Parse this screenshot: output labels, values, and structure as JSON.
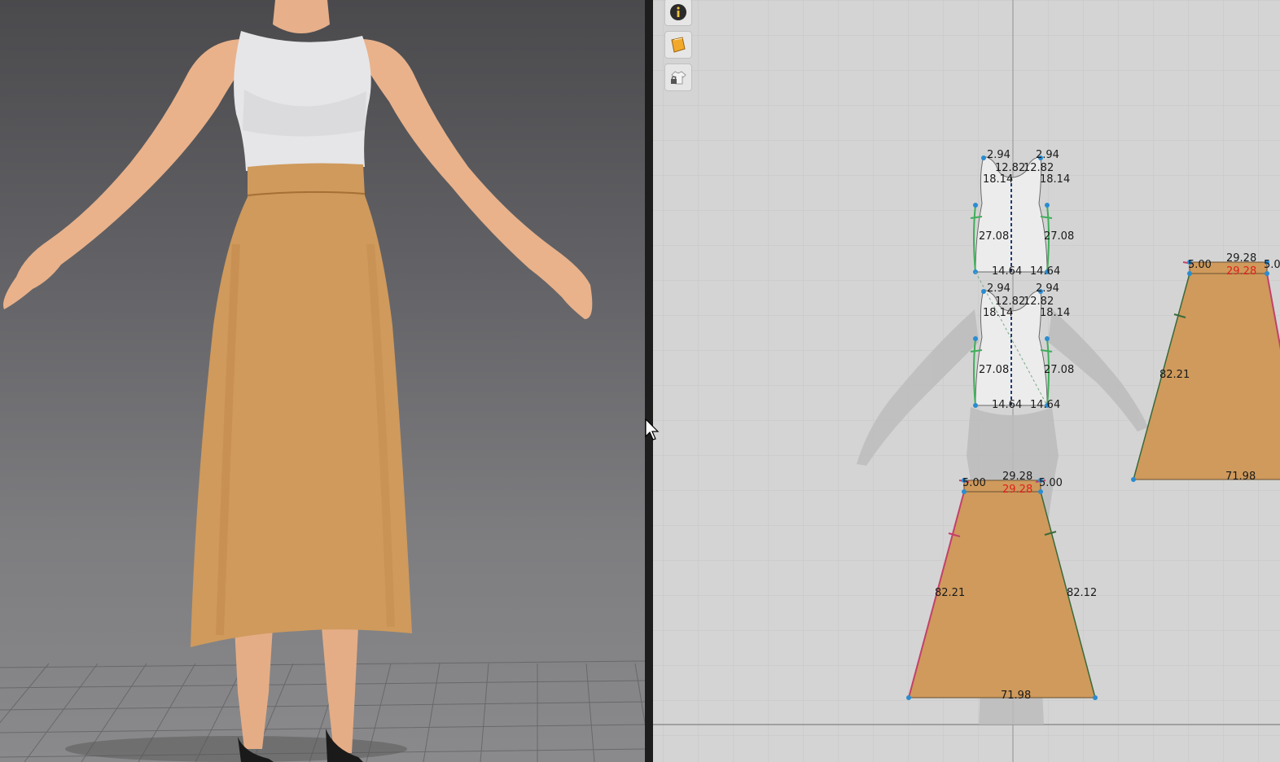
{
  "colors": {
    "skirt_fabric": "#cf9a5c",
    "top_fabric": "#e8e8ea",
    "viewport2d_bg": "#d4d4d4",
    "highlight_red": "#e0201c"
  },
  "toolbar2d": {
    "info_icon": "info-icon",
    "fabric_icon": "fabric-swatch-icon",
    "lock_icon": "garment-lock-icon"
  },
  "patterns": {
    "bodice_front": {
      "shoulder_left": "2.94",
      "shoulder_right": "2.94",
      "neck_left": "12.82",
      "neck_right": "12.82",
      "armhole_left": "18.14",
      "armhole_right": "18.14",
      "side_left": "27.08",
      "side_right": "27.08",
      "hem_left": "14.64",
      "hem_right": "14.64"
    },
    "bodice_back": {
      "shoulder_left": "2.94",
      "shoulder_right": "2.94",
      "neck_left": "12.82",
      "neck_right": "12.82",
      "armhole_left": "18.14",
      "armhole_right": "18.14",
      "side_left": "27.08",
      "side_right": "27.08",
      "hem_left": "14.64",
      "hem_right": "14.64"
    },
    "skirt_front": {
      "waist_top": "29.28",
      "waist_inner": "29.28",
      "band_left": "5.00",
      "band_right": "5.00",
      "side_left": "82.21",
      "side_right": "82.12",
      "hem": "71.98"
    },
    "skirt_back": {
      "waist_top": "29.28",
      "waist_inner": "29.28",
      "band_left": "5.00",
      "band_right": "5.0",
      "side_left": "82.21",
      "hem": "71.98"
    }
  }
}
